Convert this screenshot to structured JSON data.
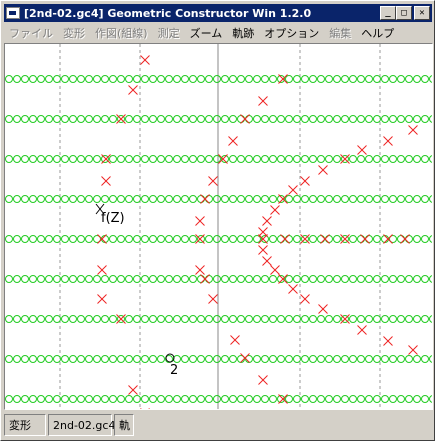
{
  "window": {
    "title": "[2nd-02.gc4] Geometric Constructor Win 1.2.0"
  },
  "menu": [
    {
      "label": "ファイル",
      "disabled": true
    },
    {
      "label": "変形",
      "disabled": true
    },
    {
      "label": "作図(組線)",
      "disabled": true
    },
    {
      "label": "測定",
      "disabled": true
    },
    {
      "label": "ズーム",
      "disabled": false
    },
    {
      "label": "軌跡",
      "disabled": false
    },
    {
      "label": "オプション",
      "disabled": false
    },
    {
      "label": "編集",
      "disabled": true
    },
    {
      "label": "ヘルプ",
      "disabled": false
    }
  ],
  "canvas": {
    "labels": {
      "point_z": "f(Z)",
      "point_2": "2"
    },
    "colors": {
      "trace": "#22cc22",
      "marker": "#ee2222",
      "grid": "#9a9a9a",
      "axis": "#888888",
      "point": "#000000"
    }
  },
  "status": {
    "mode": "変形",
    "file": "2nd-02.gc4",
    "trace": "軌"
  }
}
